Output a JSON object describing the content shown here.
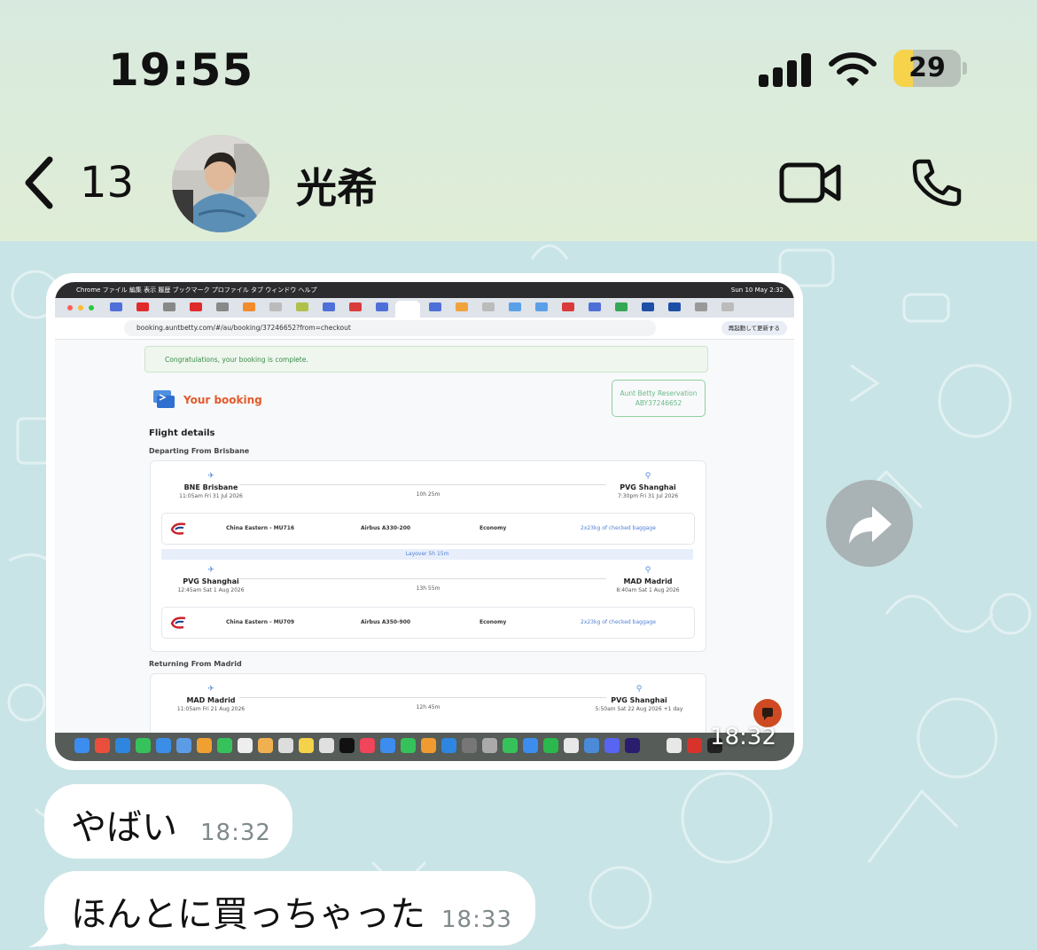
{
  "status_bar": {
    "time": "19:55",
    "battery": "29",
    "battery_level": 0.29
  },
  "header": {
    "back_count": "13",
    "contact_name": "光希"
  },
  "media_message": {
    "timestamp": "18:32",
    "screenshot": {
      "menubar": {
        "left": "Chrome   ファイル   編集   表示   履歴   ブックマーク   プロファイル   タブ   ウィンドウ   ヘルプ",
        "right": "Sun 10 May  2:32"
      },
      "url": "booking.auntbetty.com/#/au/booking/37246652?from=checkout",
      "relaunch_label": "再起動して更新する",
      "success_text": "Congratulations, your booking is complete.",
      "title": "Your booking",
      "reservation_label": "Aunt Betty Reservation",
      "reservation_code": "ABY37246652",
      "flight_details": "Flight details",
      "departing_label": "Departing From Brisbane",
      "returning_label": "Returning From Madrid",
      "legs": [
        {
          "from_city": "BNE Brisbane",
          "from_time": "11:05am Fri 31 Jul 2026",
          "duration": "10h 25m",
          "to_city": "PVG Shanghai",
          "to_time": "7:30pm Fri 31 Jul 2026",
          "airline": "China Eastern - MU716",
          "aircraft": "Airbus A330-200",
          "cabin": "Economy",
          "baggage": "2x23kg of checked baggage"
        },
        {
          "from_city": "PVG Shanghai",
          "from_time": "12:45am Sat 1 Aug 2026",
          "duration": "13h 55m",
          "to_city": "MAD Madrid",
          "to_time": "8:40am Sat 1 Aug 2026",
          "airline": "China Eastern - MU709",
          "aircraft": "Airbus A350-900",
          "cabin": "Economy",
          "baggage": "2x23kg of checked baggage"
        },
        {
          "from_city": "MAD Madrid",
          "from_time": "11:05am Fri 21 Aug 2026",
          "duration": "12h 45m",
          "to_city": "PVG Shanghai",
          "to_time": "5:50am Sat 22 Aug 2026 +1 day"
        }
      ],
      "layover": "Layover 5h 15m"
    }
  },
  "messages": [
    {
      "text": "やばい",
      "time": "18:32"
    },
    {
      "text": "ほんとに買っちゃった",
      "time": "18:33"
    }
  ],
  "icons": [
    "back-chevron-icon",
    "video-camera-icon",
    "phone-icon",
    "forward-icon",
    "wifi-icon",
    "signal-icon"
  ],
  "colors": {
    "header_bg": "#dcecd9",
    "chat_bg": "#c9e4e6",
    "bubble": "#ffffff",
    "accent_orange": "#e35a2c"
  }
}
